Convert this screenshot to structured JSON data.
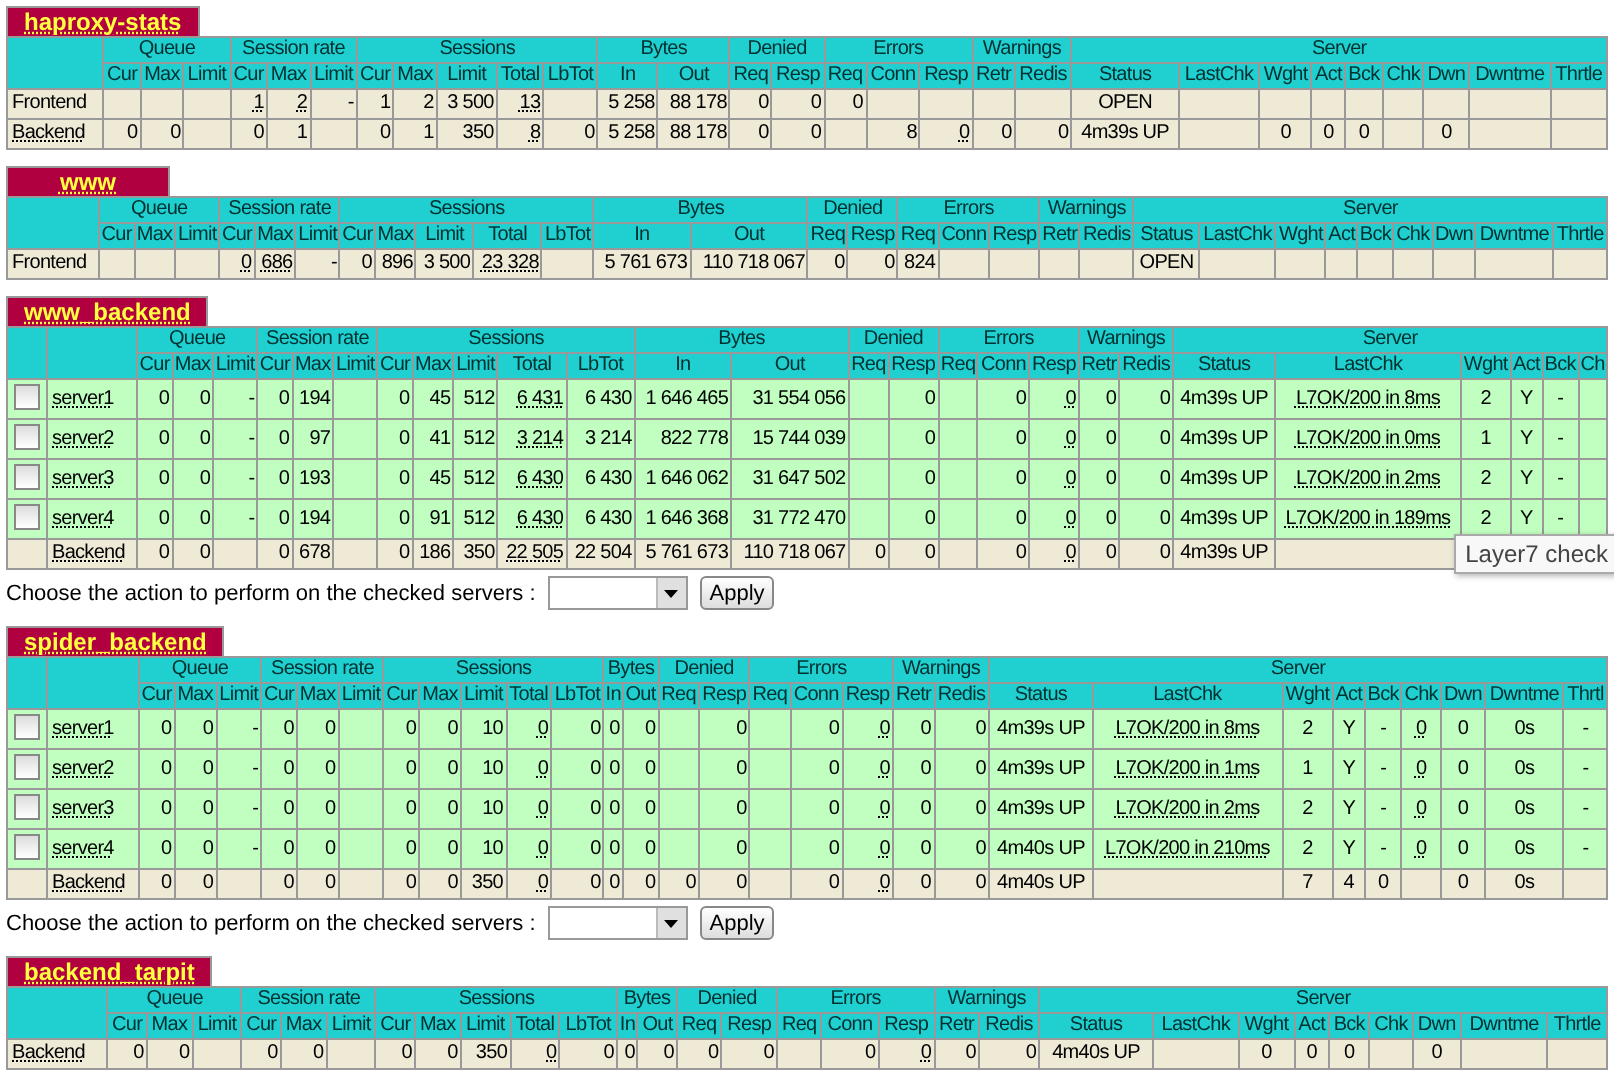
{
  "sections": [
    {
      "name": "haproxy-stats",
      "selectable": false,
      "groups": [
        {
          "label": "Queue",
          "columns": [
            "Cur",
            "Max",
            "Limit"
          ]
        },
        {
          "label": "Session rate",
          "columns": [
            "Cur",
            "Max",
            "Limit"
          ]
        },
        {
          "label": "Sessions",
          "columns": [
            "Cur",
            "Max",
            "Limit",
            "Total",
            "LbTot"
          ]
        },
        {
          "label": "Bytes",
          "columns": [
            "In",
            "Out"
          ]
        },
        {
          "label": "Denied",
          "columns": [
            "Req",
            "Resp"
          ]
        },
        {
          "label": "Errors",
          "columns": [
            "Req",
            "Conn",
            "Resp"
          ]
        },
        {
          "label": "Warnings",
          "columns": [
            "Retr",
            "Redis"
          ]
        },
        {
          "label": "Server",
          "columns": [
            "Status",
            "LastChk",
            "Wght",
            "Act",
            "Bck",
            "Chk",
            "Dwn",
            "Dwntme",
            "Thrtle"
          ]
        }
      ],
      "rows": [
        {
          "kind": "frontend",
          "name": "Frontend",
          "cells": [
            null,
            null,
            null,
            {
              "text": "1",
              "tip": true
            },
            {
              "text": "2",
              "tip": true
            },
            "-",
            "1",
            "2",
            "3 500",
            {
              "text": "13",
              "tip": true
            },
            null,
            "5 258",
            "88 178",
            "0",
            "0",
            "0",
            null,
            null,
            null,
            null,
            "OPEN",
            null,
            null,
            null,
            null,
            null,
            null,
            null,
            null
          ]
        },
        {
          "kind": "backend",
          "name": "Backend",
          "cells": [
            "0",
            "0",
            null,
            "0",
            "1",
            null,
            "0",
            "1",
            "350",
            {
              "text": "8",
              "tip": true
            },
            "0",
            "5 258",
            "88 178",
            "0",
            "0",
            null,
            "8",
            {
              "text": "0",
              "tip": true
            },
            "0",
            "0",
            "4m39s UP",
            null,
            "0",
            "0",
            "0",
            null,
            "0",
            null,
            null
          ]
        }
      ]
    },
    {
      "name": "www",
      "selectable": false,
      "groups": [
        {
          "label": "Queue",
          "columns": [
            "Cur",
            "Max",
            "Limit"
          ]
        },
        {
          "label": "Session rate",
          "columns": [
            "Cur",
            "Max",
            "Limit"
          ]
        },
        {
          "label": "Sessions",
          "columns": [
            "Cur",
            "Max",
            "Limit",
            "Total",
            "LbTot"
          ]
        },
        {
          "label": "Bytes",
          "columns": [
            "In",
            "Out"
          ]
        },
        {
          "label": "Denied",
          "columns": [
            "Req",
            "Resp"
          ]
        },
        {
          "label": "Errors",
          "columns": [
            "Req",
            "Conn",
            "Resp"
          ]
        },
        {
          "label": "Warnings",
          "columns": [
            "Retr",
            "Redis"
          ]
        },
        {
          "label": "Server",
          "columns": [
            "Status",
            "LastChk",
            "Wght",
            "Act",
            "Bck",
            "Chk",
            "Dwn",
            "Dwntme",
            "Thrtle"
          ]
        }
      ],
      "rows": [
        {
          "kind": "frontend",
          "name": "Frontend",
          "cells": [
            null,
            null,
            null,
            {
              "text": "0",
              "tip": true
            },
            {
              "text": "686",
              "tip": true
            },
            "-",
            "0",
            "896",
            "3 500",
            {
              "text": "23 328",
              "tip": true
            },
            null,
            "5 761 673",
            "110 718 067",
            "0",
            "0",
            "824",
            null,
            null,
            null,
            null,
            "OPEN",
            null,
            null,
            null,
            null,
            null,
            null,
            null,
            null
          ]
        }
      ]
    },
    {
      "name": "www_backend",
      "selectable": true,
      "tooltip": "Layer7 check",
      "groups": [
        {
          "label": "Queue",
          "columns": [
            "Cur",
            "Max",
            "Limit"
          ]
        },
        {
          "label": "Session rate",
          "columns": [
            "Cur",
            "Max",
            "Limit"
          ]
        },
        {
          "label": "Sessions",
          "columns": [
            "Cur",
            "Max",
            "Limit",
            "Total",
            "LbTot"
          ]
        },
        {
          "label": "Bytes",
          "columns": [
            "In",
            "Out"
          ]
        },
        {
          "label": "Denied",
          "columns": [
            "Req",
            "Resp"
          ]
        },
        {
          "label": "Errors",
          "columns": [
            "Req",
            "Conn",
            "Resp"
          ]
        },
        {
          "label": "Warnings",
          "columns": [
            "Retr",
            "Redis"
          ]
        },
        {
          "label": "Server",
          "columns": [
            "Status",
            "LastChk",
            "Wght",
            "Act",
            "Bck",
            "Ch"
          ]
        }
      ],
      "rows": [
        {
          "kind": "server",
          "name": "server1",
          "checked": false,
          "cells": [
            "0",
            "0",
            "-",
            "0",
            "194",
            null,
            "0",
            "45",
            "512",
            {
              "text": "6 431",
              "tip": true
            },
            "6 430",
            "1 646 465",
            "31 554 056",
            null,
            "0",
            null,
            "0",
            {
              "text": "0",
              "tip": true
            },
            "0",
            "0",
            "4m39s UP",
            {
              "text": "L7OK/200 in 8ms",
              "tip": true
            },
            "2",
            "Y",
            "-",
            null
          ]
        },
        {
          "kind": "server",
          "name": "server2",
          "checked": false,
          "cells": [
            "0",
            "0",
            "-",
            "0",
            "97",
            null,
            "0",
            "41",
            "512",
            {
              "text": "3 214",
              "tip": true
            },
            "3 214",
            "822 778",
            "15 744 039",
            null,
            "0",
            null,
            "0",
            {
              "text": "0",
              "tip": true
            },
            "0",
            "0",
            "4m39s UP",
            {
              "text": "L7OK/200 in 0ms",
              "tip": true
            },
            "1",
            "Y",
            "-",
            null
          ]
        },
        {
          "kind": "server",
          "name": "server3",
          "checked": false,
          "cells": [
            "0",
            "0",
            "-",
            "0",
            "193",
            null,
            "0",
            "45",
            "512",
            {
              "text": "6 430",
              "tip": true
            },
            "6 430",
            "1 646 062",
            "31 647 502",
            null,
            "0",
            null,
            "0",
            {
              "text": "0",
              "tip": true
            },
            "0",
            "0",
            "4m39s UP",
            {
              "text": "L7OK/200 in 2ms",
              "tip": true
            },
            "2",
            "Y",
            "-",
            null
          ]
        },
        {
          "kind": "server",
          "name": "server4",
          "checked": false,
          "cells": [
            "0",
            "0",
            "-",
            "0",
            "194",
            null,
            "0",
            "91",
            "512",
            {
              "text": "6 430",
              "tip": true
            },
            "6 430",
            "1 646 368",
            "31 772 470",
            null,
            "0",
            null,
            "0",
            {
              "text": "0",
              "tip": true
            },
            "0",
            "0",
            "4m39s UP",
            {
              "text": "L7OK/200 in 189ms",
              "tip": true
            },
            "2",
            "Y",
            "-",
            null
          ]
        },
        {
          "kind": "backend",
          "name": "Backend",
          "cells": [
            "0",
            "0",
            null,
            "0",
            "678",
            null,
            "0",
            "186",
            "350",
            {
              "text": "22 505",
              "tip": true
            },
            "22 504",
            "5 761 673",
            "110 718 067",
            "0",
            "0",
            null,
            "0",
            {
              "text": "0",
              "tip": true
            },
            "0",
            "0",
            "4m39s UP",
            null,
            null,
            null,
            null,
            null
          ]
        }
      ],
      "action_form": {
        "label": "Choose the action to perform on the checked servers :",
        "button": "Apply"
      }
    },
    {
      "name": "spider_backend",
      "selectable": true,
      "groups": [
        {
          "label": "Queue",
          "columns": [
            "Cur",
            "Max",
            "Limit"
          ]
        },
        {
          "label": "Session rate",
          "columns": [
            "Cur",
            "Max",
            "Limit"
          ]
        },
        {
          "label": "Sessions",
          "columns": [
            "Cur",
            "Max",
            "Limit",
            "Total",
            "LbTot"
          ]
        },
        {
          "label": "Bytes",
          "columns": [
            "In",
            "Out"
          ]
        },
        {
          "label": "Denied",
          "columns": [
            "Req",
            "Resp"
          ]
        },
        {
          "label": "Errors",
          "columns": [
            "Req",
            "Conn",
            "Resp"
          ]
        },
        {
          "label": "Warnings",
          "columns": [
            "Retr",
            "Redis"
          ]
        },
        {
          "label": "Server",
          "columns": [
            "Status",
            "LastChk",
            "Wght",
            "Act",
            "Bck",
            "Chk",
            "Dwn",
            "Dwntme",
            "Thrtl"
          ]
        }
      ],
      "rows": [
        {
          "kind": "server",
          "name": "server1",
          "checked": false,
          "cells": [
            "0",
            "0",
            "-",
            "0",
            "0",
            null,
            "0",
            "0",
            "10",
            {
              "text": "0",
              "tip": true
            },
            "0",
            "0",
            "0",
            null,
            "0",
            null,
            "0",
            {
              "text": "0",
              "tip": true
            },
            "0",
            "0",
            "4m39s UP",
            {
              "text": "L7OK/200 in 8ms",
              "tip": true
            },
            "2",
            "Y",
            "-",
            {
              "text": "0",
              "tip": true
            },
            "0",
            "0s",
            "-"
          ]
        },
        {
          "kind": "server",
          "name": "server2",
          "checked": false,
          "cells": [
            "0",
            "0",
            "-",
            "0",
            "0",
            null,
            "0",
            "0",
            "10",
            {
              "text": "0",
              "tip": true
            },
            "0",
            "0",
            "0",
            null,
            "0",
            null,
            "0",
            {
              "text": "0",
              "tip": true
            },
            "0",
            "0",
            "4m39s UP",
            {
              "text": "L7OK/200 in 1ms",
              "tip": true
            },
            "1",
            "Y",
            "-",
            {
              "text": "0",
              "tip": true
            },
            "0",
            "0s",
            "-"
          ]
        },
        {
          "kind": "server",
          "name": "server3",
          "checked": false,
          "cells": [
            "0",
            "0",
            "-",
            "0",
            "0",
            null,
            "0",
            "0",
            "10",
            {
              "text": "0",
              "tip": true
            },
            "0",
            "0",
            "0",
            null,
            "0",
            null,
            "0",
            {
              "text": "0",
              "tip": true
            },
            "0",
            "0",
            "4m39s UP",
            {
              "text": "L7OK/200 in 2ms",
              "tip": true
            },
            "2",
            "Y",
            "-",
            {
              "text": "0",
              "tip": true
            },
            "0",
            "0s",
            "-"
          ]
        },
        {
          "kind": "server",
          "name": "server4",
          "checked": false,
          "cells": [
            "0",
            "0",
            "-",
            "0",
            "0",
            null,
            "0",
            "0",
            "10",
            {
              "text": "0",
              "tip": true
            },
            "0",
            "0",
            "0",
            null,
            "0",
            null,
            "0",
            {
              "text": "0",
              "tip": true
            },
            "0",
            "0",
            "4m40s UP",
            {
              "text": "L7OK/200 in 210ms",
              "tip": true
            },
            "2",
            "Y",
            "-",
            {
              "text": "0",
              "tip": true
            },
            "0",
            "0s",
            "-"
          ]
        },
        {
          "kind": "backend",
          "name": "Backend",
          "cells": [
            "0",
            "0",
            null,
            "0",
            "0",
            null,
            "0",
            "0",
            "350",
            {
              "text": "0",
              "tip": true
            },
            "0",
            "0",
            "0",
            "0",
            "0",
            null,
            "0",
            {
              "text": "0",
              "tip": true
            },
            "0",
            "0",
            "4m40s UP",
            null,
            "7",
            "4",
            "0",
            null,
            "0",
            "0s",
            null
          ]
        }
      ],
      "action_form": {
        "label": "Choose the action to perform on the checked servers :",
        "button": "Apply"
      }
    },
    {
      "name": "backend_tarpit",
      "selectable": false,
      "groups": [
        {
          "label": "Queue",
          "columns": [
            "Cur",
            "Max",
            "Limit"
          ]
        },
        {
          "label": "Session rate",
          "columns": [
            "Cur",
            "Max",
            "Limit"
          ]
        },
        {
          "label": "Sessions",
          "columns": [
            "Cur",
            "Max",
            "Limit",
            "Total",
            "LbTot"
          ]
        },
        {
          "label": "Bytes",
          "columns": [
            "In",
            "Out"
          ]
        },
        {
          "label": "Denied",
          "columns": [
            "Req",
            "Resp"
          ]
        },
        {
          "label": "Errors",
          "columns": [
            "Req",
            "Conn",
            "Resp"
          ]
        },
        {
          "label": "Warnings",
          "columns": [
            "Retr",
            "Redis"
          ]
        },
        {
          "label": "Server",
          "columns": [
            "Status",
            "LastChk",
            "Wght",
            "Act",
            "Bck",
            "Chk",
            "Dwn",
            "Dwntme",
            "Thrtle"
          ]
        }
      ],
      "rows": [
        {
          "kind": "backend",
          "name": "Backend",
          "cells": [
            "0",
            "0",
            null,
            "0",
            "0",
            null,
            "0",
            "0",
            "350",
            {
              "text": "0",
              "tip": true
            },
            "0",
            "0",
            "0",
            "0",
            "0",
            null,
            "0",
            {
              "text": "0",
              "tip": true
            },
            "0",
            "0",
            "4m40s UP",
            null,
            "0",
            "0",
            "0",
            null,
            "0",
            null,
            null
          ]
        }
      ]
    }
  ]
}
